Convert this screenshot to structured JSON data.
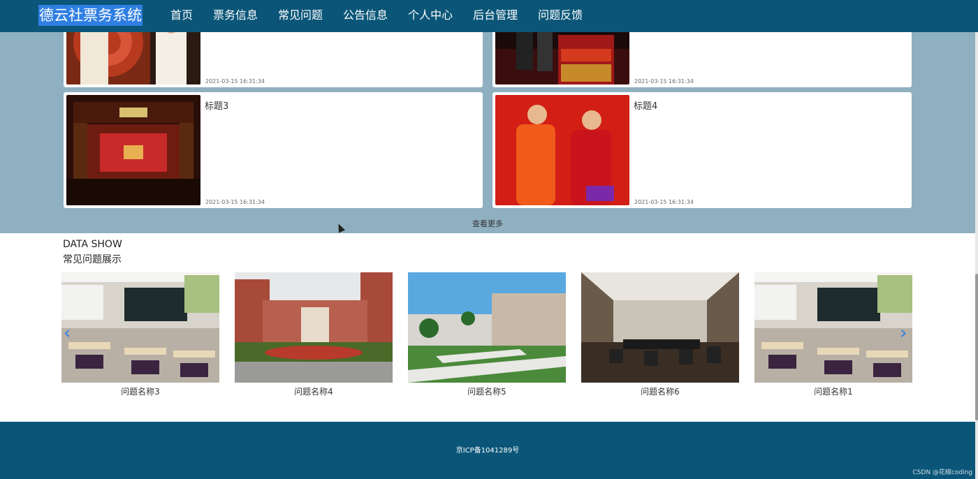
{
  "header": {
    "brand": "德云社票务系统",
    "nav": [
      "首页",
      "票务信息",
      "常见问题",
      "公告信息",
      "个人中心",
      "后台管理",
      "问题反馈"
    ]
  },
  "news": {
    "cards": [
      {
        "title": "",
        "date": "2021-03-15 16:31:34"
      },
      {
        "title": "",
        "date": "2021-03-15 16:31:34"
      },
      {
        "title": "标题3",
        "date": "2021-03-15 16:31:34"
      },
      {
        "title": "标题4",
        "date": "2021-03-15 16:31:34"
      }
    ],
    "view_more": "查看更多"
  },
  "data_show": {
    "title": "DATA SHOW",
    "subtitle": "常见问题展示",
    "items": [
      {
        "name": "问题名称3"
      },
      {
        "name": "问题名称4"
      },
      {
        "name": "问题名称5"
      },
      {
        "name": "问题名称6"
      },
      {
        "name": "问题名称1"
      }
    ],
    "prev_icon": "chevron-left-icon",
    "next_icon": "chevron-right-icon"
  },
  "footer": {
    "icp": "京ICP备1041289号",
    "watermark": "CSDN @花椒coding"
  },
  "colors": {
    "header_bg": "#0b5678",
    "section_bg": "#8fb0c0",
    "brand_highlight": "#2f7fe3"
  }
}
